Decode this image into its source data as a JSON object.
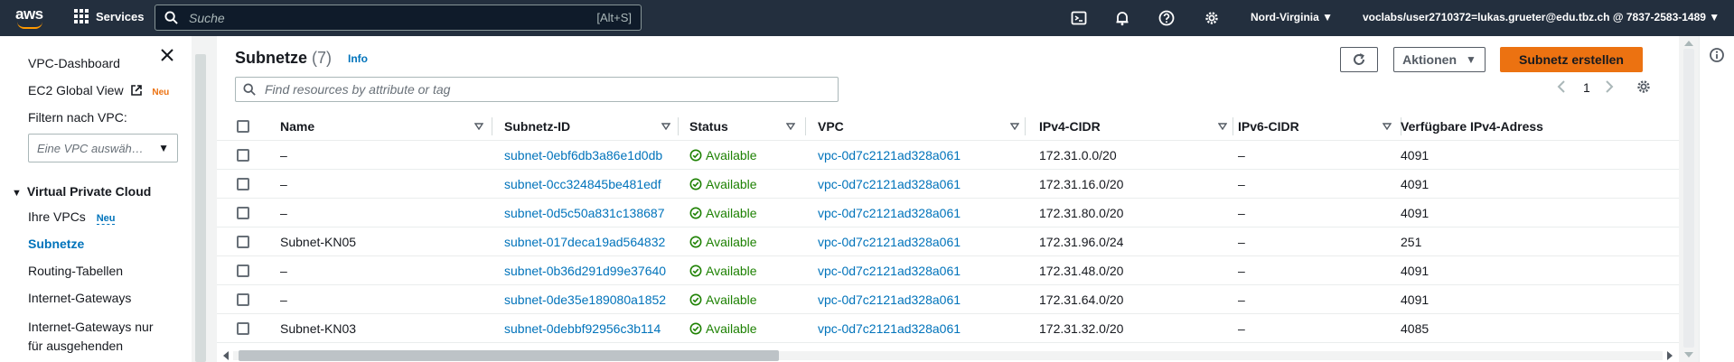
{
  "nav": {
    "logo": "aws",
    "services_label": "Services",
    "search_placeholder": "Suche",
    "search_shortcut": "[Alt+S]",
    "region": "Nord-Virginia ▼",
    "account": "voclabs/user2710372=lukas.grueter@edu.tbz.ch @ 7837-2583-1489 ▼"
  },
  "sidebar": {
    "dashboard": "VPC-Dashboard",
    "ec2_global": "EC2 Global View",
    "ec2_badge": "Neu",
    "filter_label": "Filtern nach VPC:",
    "vpc_select_placeholder": "Eine VPC auswäh…",
    "section": "Virtual Private Cloud",
    "items": [
      {
        "label": "Ihre VPCs",
        "badge": "Neu"
      },
      {
        "label": "Subnetze"
      },
      {
        "label": "Routing-Tabellen"
      },
      {
        "label": "Internet-Gateways"
      },
      {
        "label": "Internet-Gateways nur"
      },
      {
        "label": "für ausgehenden"
      }
    ]
  },
  "header": {
    "title": "Subnetze",
    "count": "(7)",
    "info": "Info",
    "actions_label": "Aktionen",
    "create_label": "Subnetz erstellen",
    "filter_placeholder": "Find resources by attribute or tag",
    "page": "1"
  },
  "table": {
    "columns": [
      "Name",
      "Subnetz-ID",
      "Status",
      "VPC",
      "IPv4-CIDR",
      "IPv6-CIDR",
      "Verfügbare IPv4-Adress"
    ],
    "rows": [
      {
        "name": "–",
        "id": "subnet-0ebf6db3a86e1d0db",
        "status": "Available",
        "vpc": "vpc-0d7c2121ad328a061",
        "ipv4": "172.31.0.0/20",
        "ipv6": "–",
        "avail": "4091"
      },
      {
        "name": "–",
        "id": "subnet-0cc324845be481edf",
        "status": "Available",
        "vpc": "vpc-0d7c2121ad328a061",
        "ipv4": "172.31.16.0/20",
        "ipv6": "–",
        "avail": "4091"
      },
      {
        "name": "–",
        "id": "subnet-0d5c50a831c138687",
        "status": "Available",
        "vpc": "vpc-0d7c2121ad328a061",
        "ipv4": "172.31.80.0/20",
        "ipv6": "–",
        "avail": "4091"
      },
      {
        "name": "Subnet-KN05",
        "id": "subnet-017deca19ad564832",
        "status": "Available",
        "vpc": "vpc-0d7c2121ad328a061",
        "ipv4": "172.31.96.0/24",
        "ipv6": "–",
        "avail": "251"
      },
      {
        "name": "–",
        "id": "subnet-0b36d291d99e37640",
        "status": "Available",
        "vpc": "vpc-0d7c2121ad328a061",
        "ipv4": "172.31.48.0/20",
        "ipv6": "–",
        "avail": "4091"
      },
      {
        "name": "–",
        "id": "subnet-0de35e189080a1852",
        "status": "Available",
        "vpc": "vpc-0d7c2121ad328a061",
        "ipv4": "172.31.64.0/20",
        "ipv6": "–",
        "avail": "4091"
      },
      {
        "name": "Subnet-KN03",
        "id": "subnet-0debbf92956c3b114",
        "status": "Available",
        "vpc": "vpc-0d7c2121ad328a061",
        "ipv4": "172.31.32.0/20",
        "ipv6": "–",
        "avail": "4085"
      }
    ]
  },
  "colors": {
    "nav_bg": "#232f3e",
    "accent": "#ec7211",
    "link": "#0073bb",
    "success": "#1d8102"
  }
}
